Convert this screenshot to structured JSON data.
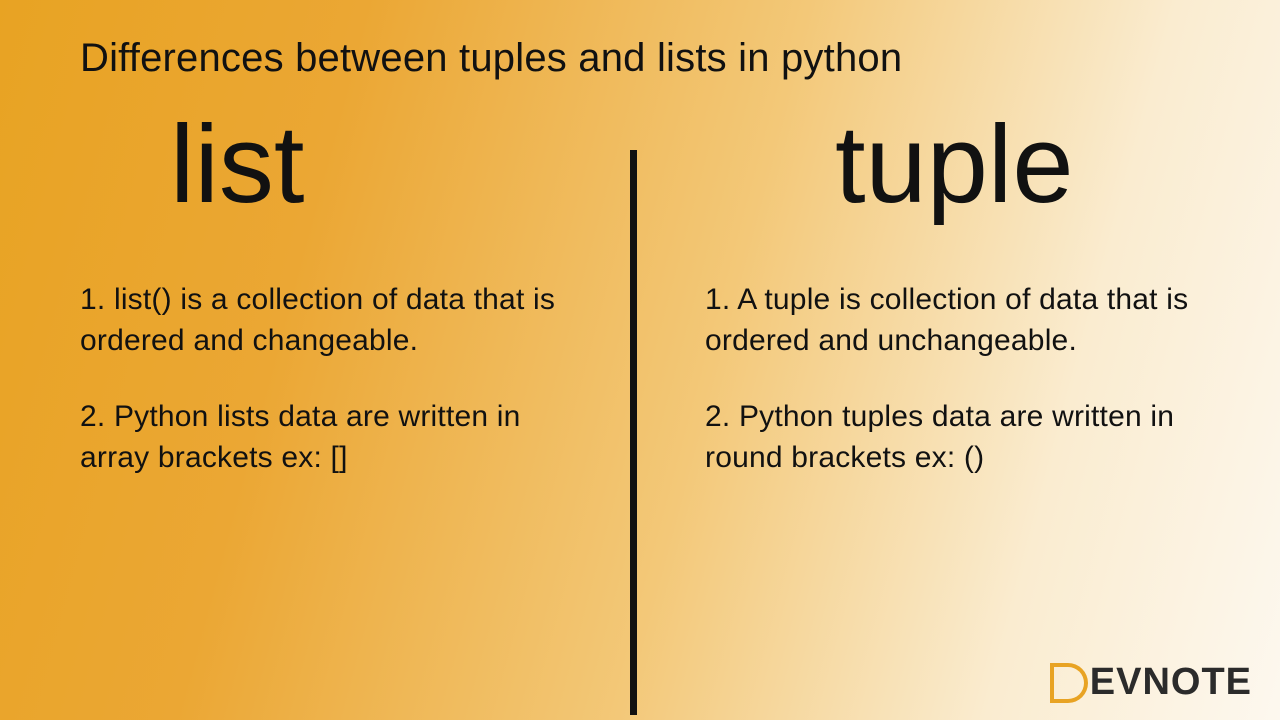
{
  "title": "Differences between tuples and lists in python",
  "left": {
    "heading": "list",
    "point1": "1. list() is a collection of data\n that is ordered and changeable.",
    "point2": "2. Python lists data are written in array brackets ex: []"
  },
  "right": {
    "heading": "tuple",
    "point1": "1. A tuple is collection of data that is ordered and unchangeable.",
    "point2": "2. Python tuples data are written in round brackets\n ex: ()"
  },
  "logo": {
    "text": "EVNOTE"
  }
}
